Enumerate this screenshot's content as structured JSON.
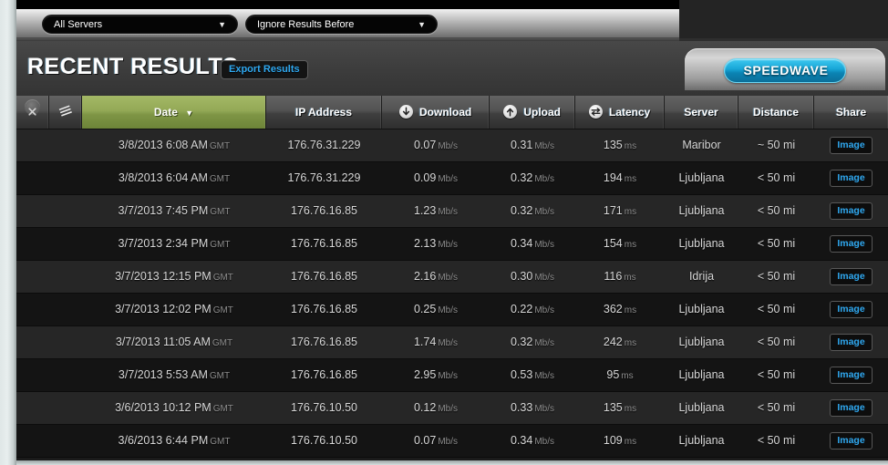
{
  "toolbar": {
    "server_filter": {
      "label": "All Servers",
      "caret": "▼"
    },
    "date_filter": {
      "label": "Ignore Results Before",
      "caret": "▼"
    }
  },
  "panel": {
    "title": "RECENT RESULTS",
    "export_label": "Export Results",
    "brand": "SPEEDWAVE"
  },
  "table": {
    "icons": {
      "close": "close-icon",
      "attach": "layers-icon"
    },
    "columns": [
      {
        "key": "date",
        "label": "Date",
        "sort_caret": "▼",
        "sorted": true
      },
      {
        "key": "ip",
        "label": "IP Address"
      },
      {
        "key": "download",
        "label": "Download",
        "icon": "download-arrow-icon"
      },
      {
        "key": "upload",
        "label": "Upload",
        "icon": "upload-arrow-icon"
      },
      {
        "key": "latency",
        "label": "Latency",
        "icon": "latency-exchange-icon"
      },
      {
        "key": "server",
        "label": "Server"
      },
      {
        "key": "distance",
        "label": "Distance"
      },
      {
        "key": "share",
        "label": "Share"
      }
    ],
    "units": {
      "speed": "Mb/s",
      "latency": "ms",
      "timezone": "GMT"
    },
    "share_label": "Image",
    "rows": [
      {
        "date": "3/8/2013 6:08 AM",
        "tz": "GMT",
        "ip": "176.76.31.229",
        "download": "0.07",
        "upload": "0.31",
        "latency": "135",
        "server": "Maribor",
        "distance": "~ 50 mi",
        "share": "Image"
      },
      {
        "date": "3/8/2013 6:04 AM",
        "tz": "GMT",
        "ip": "176.76.31.229",
        "download": "0.09",
        "upload": "0.32",
        "latency": "194",
        "server": "Ljubljana",
        "distance": "< 50 mi",
        "share": "Image"
      },
      {
        "date": "3/7/2013 7:45 PM",
        "tz": "GMT",
        "ip": "176.76.16.85",
        "download": "1.23",
        "upload": "0.32",
        "latency": "171",
        "server": "Ljubljana",
        "distance": "< 50 mi",
        "share": "Image"
      },
      {
        "date": "3/7/2013 2:34 PM",
        "tz": "GMT",
        "ip": "176.76.16.85",
        "download": "2.13",
        "upload": "0.34",
        "latency": "154",
        "server": "Ljubljana",
        "distance": "< 50 mi",
        "share": "Image"
      },
      {
        "date": "3/7/2013 12:15 PM",
        "tz": "GMT",
        "ip": "176.76.16.85",
        "download": "2.16",
        "upload": "0.30",
        "latency": "116",
        "server": "Idrija",
        "distance": "< 50 mi",
        "share": "Image"
      },
      {
        "date": "3/7/2013 12:02 PM",
        "tz": "GMT",
        "ip": "176.76.16.85",
        "download": "0.25",
        "upload": "0.22",
        "latency": "362",
        "server": "Ljubljana",
        "distance": "< 50 mi",
        "share": "Image"
      },
      {
        "date": "3/7/2013 11:05 AM",
        "tz": "GMT",
        "ip": "176.76.16.85",
        "download": "1.74",
        "upload": "0.32",
        "latency": "242",
        "server": "Ljubljana",
        "distance": "< 50 mi",
        "share": "Image"
      },
      {
        "date": "3/7/2013 5:53 AM",
        "tz": "GMT",
        "ip": "176.76.16.85",
        "download": "2.95",
        "upload": "0.53",
        "latency": "95",
        "server": "Ljubljana",
        "distance": "< 50 mi",
        "share": "Image"
      },
      {
        "date": "3/6/2013 10:12 PM",
        "tz": "GMT",
        "ip": "176.76.10.50",
        "download": "0.12",
        "upload": "0.33",
        "latency": "135",
        "server": "Ljubljana",
        "distance": "< 50 mi",
        "share": "Image"
      },
      {
        "date": "3/6/2013 6:44 PM",
        "tz": "GMT",
        "ip": "176.76.10.50",
        "download": "0.07",
        "upload": "0.34",
        "latency": "109",
        "server": "Ljubljana",
        "distance": "< 50 mi",
        "share": "Image"
      }
    ]
  },
  "colors": {
    "accent_link": "#2fa8f0",
    "sorted_header": "#93a956",
    "brand_pill": "#18a7d8",
    "row_odd": "#262626",
    "row_even": "#141414"
  }
}
